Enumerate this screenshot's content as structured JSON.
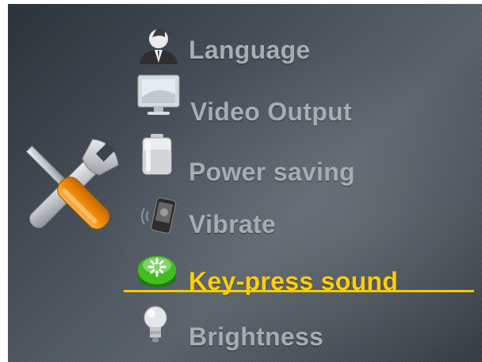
{
  "menu": {
    "items": [
      {
        "label": "Language",
        "icon": "person-icon",
        "selected": false
      },
      {
        "label": "Video Output",
        "icon": "monitor-icon",
        "selected": false
      },
      {
        "label": "Power saving",
        "icon": "battery-icon",
        "selected": false
      },
      {
        "label": "Vibrate",
        "icon": "vibrating-phone-icon",
        "selected": false
      },
      {
        "label": "Key-press sound",
        "icon": "green-button-icon",
        "selected": true
      },
      {
        "label": "Brightness",
        "icon": "light-bulb-icon",
        "selected": false
      }
    ]
  },
  "header_icon": "tools-icon",
  "colors": {
    "selected_text": "#ffd200",
    "normal_text": "#a8aeb4",
    "underline": "#f2cf00"
  }
}
